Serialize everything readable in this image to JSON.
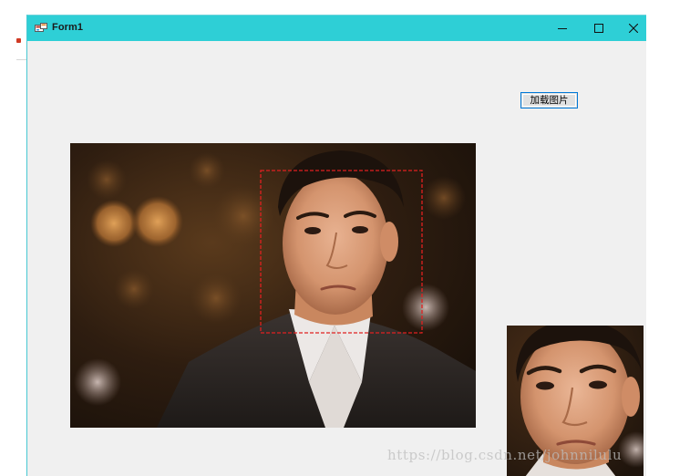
{
  "window": {
    "title": "Form1",
    "controls": {
      "minimize": "minimize",
      "maximize": "maximize",
      "close": "close"
    },
    "accent": "#2ecfd6"
  },
  "form": {
    "load_button_label": "加载图片"
  },
  "images": {
    "main_photo": "portrait-photo",
    "face_detection_box": "dashed-red-rectangle",
    "detection_color": "#e02020",
    "cropped_face": "cropped-face-thumbnail"
  },
  "watermark": {
    "text": "https://blog.csdn.net/johnnilulu"
  }
}
